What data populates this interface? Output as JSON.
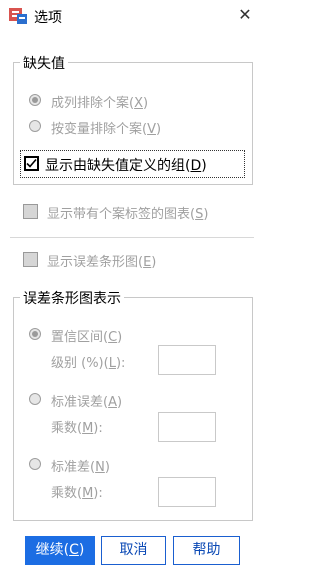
{
  "window": {
    "title": "选项",
    "close_glyph": "✕"
  },
  "missing_values": {
    "legend": "缺失值",
    "option1": {
      "label_main": "成列排除个案(",
      "key": "X",
      "label_end": ")",
      "selected": true
    },
    "option2": {
      "label_main": "按变量排除个案(",
      "key": "V",
      "label_end": ")",
      "selected": false
    },
    "checkbox": {
      "label_main": "显示由缺失值定义的组(",
      "key": "D",
      "label_end": ")",
      "checked": true
    }
  },
  "case_labels_checkbox": {
    "label_main": "显示带有个案标签的图表(",
    "key": "S",
    "label_end": ")",
    "checked": false
  },
  "error_bars_checkbox": {
    "label_main": "显示误差条形图(",
    "key": "E",
    "label_end": ")",
    "checked": false
  },
  "error_bar_repr": {
    "legend": "误差条形图表示",
    "ci": {
      "label_main": "置信区间(",
      "key": "C",
      "label_end": ")",
      "selected": true,
      "sub_label_main": "级别 (%)(",
      "sub_key": "L",
      "sub_label_end": "):",
      "value": ""
    },
    "se": {
      "label_main": "标准误差(",
      "key": "A",
      "label_end": ")",
      "selected": false,
      "sub_label_main": "乘数(",
      "sub_key": "M",
      "sub_label_end": "):",
      "value": ""
    },
    "sd": {
      "label_main": "标准差(",
      "key": "N",
      "label_end": ")",
      "selected": false,
      "sub_label_main": "乘数(",
      "sub_key": "M",
      "sub_label_end": "):",
      "value": ""
    }
  },
  "buttons": {
    "continue": {
      "label_main": "继续(",
      "key": "C",
      "label_end": ")"
    },
    "cancel": "取消",
    "help": "帮助"
  },
  "colors": {
    "primary": "#1c6de3",
    "disabled_text": "#a0a0a0",
    "border": "#c8c8c8"
  }
}
